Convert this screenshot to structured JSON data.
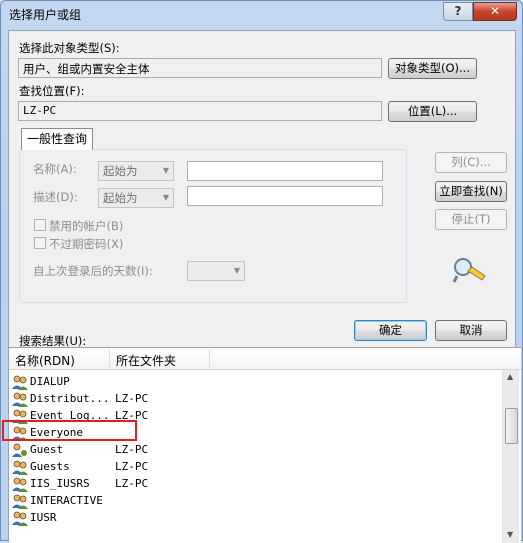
{
  "window": {
    "title": "选择用户或组",
    "help_button": "?",
    "close_button": "✕"
  },
  "object_type": {
    "label": "选择此对象类型(S):",
    "value": "用户、组或内置安全主体",
    "button": "对象类型(O)..."
  },
  "location": {
    "label": "查找位置(F):",
    "value": "LZ-PC",
    "button": "位置(L)..."
  },
  "query": {
    "tab": "一般性查询",
    "name_label": "名称(A):",
    "name_mode": "起始为",
    "desc_label": "描述(D):",
    "desc_mode": "起始为",
    "disabled_accounts": "禁用的帐户(B)",
    "non_expiring_pw": "不过期密码(X)",
    "days_since_logon": "自上次登录后的天数(I):",
    "columns_button": "列(C)...",
    "find_now_button": "立即查找(N)",
    "stop_button": "停止(T)"
  },
  "results": {
    "label": "搜索结果(U):",
    "ok_button": "确定",
    "cancel_button": "取消",
    "columns": [
      "名称(RDN)",
      "所在文件夹"
    ],
    "rows": [
      {
        "name": "DIALUP",
        "folder": ""
      },
      {
        "name": "Distribut...",
        "folder": "LZ-PC"
      },
      {
        "name": "Event Log...",
        "folder": "LZ-PC"
      },
      {
        "name": "Everyone",
        "folder": ""
      },
      {
        "name": "Guest",
        "folder": "LZ-PC"
      },
      {
        "name": "Guests",
        "folder": "LZ-PC"
      },
      {
        "name": "IIS_IUSRS",
        "folder": "LZ-PC"
      },
      {
        "name": "INTERACTIVE",
        "folder": ""
      },
      {
        "name": "IUSR",
        "folder": ""
      }
    ],
    "highlighted_row": "Everyone"
  },
  "colors": {
    "highlight_box": "#e0201e",
    "title_bar": "#c4d9f1",
    "close_button": "#c7432c"
  },
  "icons": [
    "help-icon",
    "close-icon",
    "search-flashlight-icon",
    "group-icon",
    "user-icon"
  ]
}
